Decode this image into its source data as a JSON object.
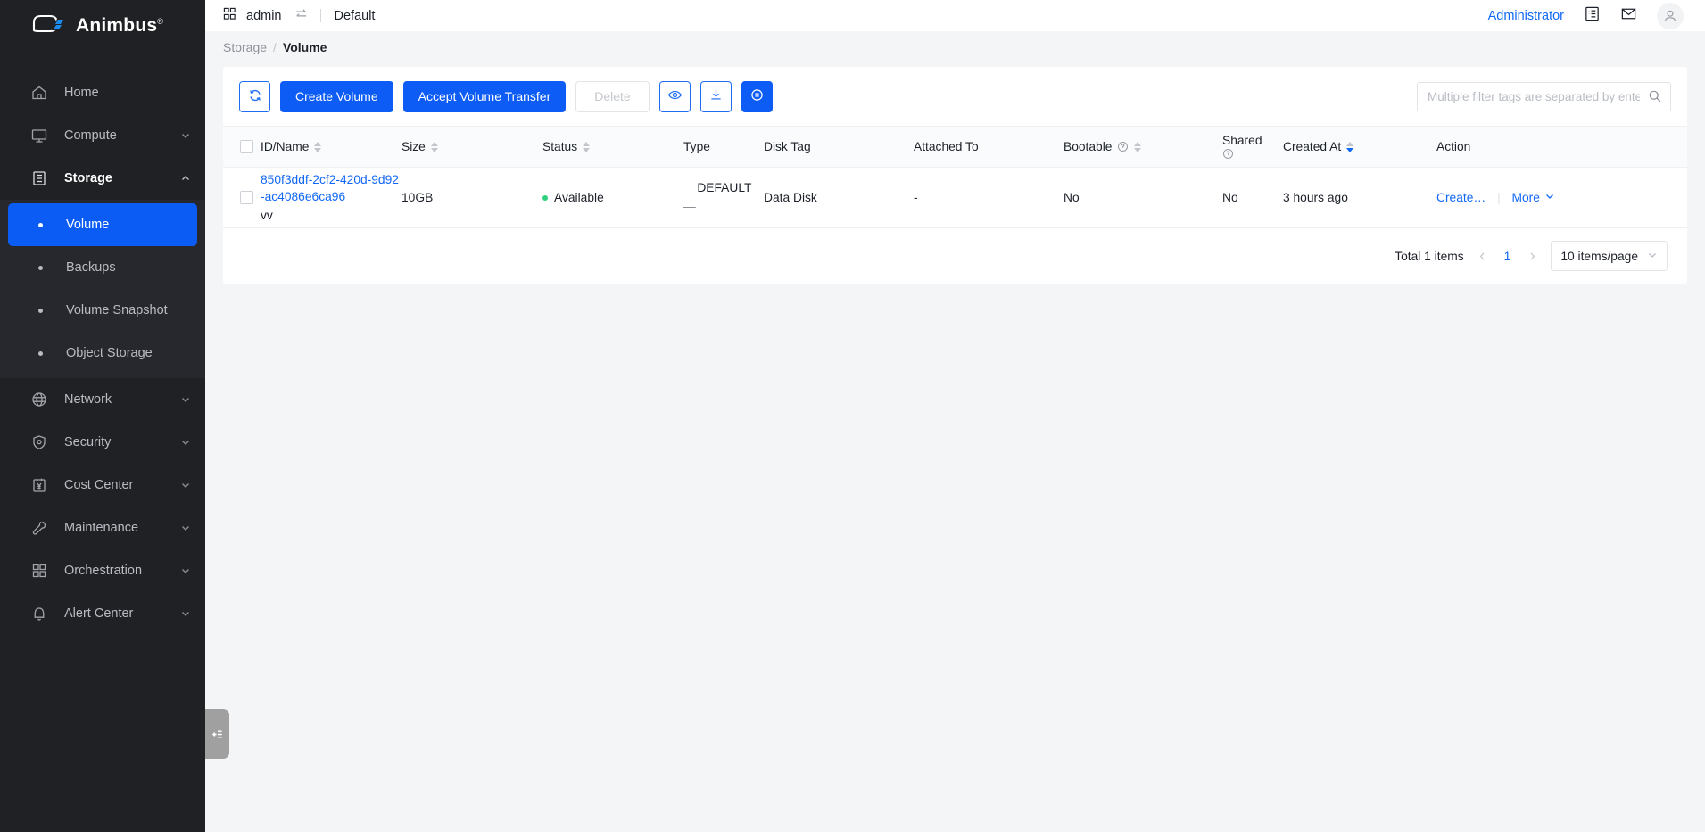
{
  "brand": {
    "name": "Animbus",
    "registered": "®"
  },
  "sidebar": {
    "items": [
      {
        "label": "Home",
        "icon": "home-icon",
        "expandable": false
      },
      {
        "label": "Compute",
        "icon": "monitor-icon",
        "expandable": true
      },
      {
        "label": "Storage",
        "icon": "server-rack-icon",
        "expandable": true,
        "expanded": true
      },
      {
        "label": "Network",
        "icon": "globe-icon",
        "expandable": true
      },
      {
        "label": "Security",
        "icon": "shield-icon",
        "expandable": true
      },
      {
        "label": "Cost Center",
        "icon": "yen-billing-icon",
        "expandable": true
      },
      {
        "label": "Maintenance",
        "icon": "wrench-icon",
        "expandable": true
      },
      {
        "label": "Orchestration",
        "icon": "grid-blocks-icon",
        "expandable": true
      },
      {
        "label": "Alert Center",
        "icon": "bell-icon",
        "expandable": true
      }
    ],
    "storage_children": [
      {
        "label": "Volume",
        "selected": true
      },
      {
        "label": "Backups",
        "selected": false
      },
      {
        "label": "Volume Snapshot",
        "selected": false
      },
      {
        "label": "Object Storage",
        "selected": false
      }
    ],
    "collapse_handle": "collapse-sidebar"
  },
  "topbar": {
    "project": "admin",
    "switch_icon": "switch-arrows-icon",
    "grid_icon": "grid-icon",
    "region": "Default",
    "administrator": "Administrator",
    "list_icon": "task-list-icon",
    "mail_icon": "envelope-icon",
    "avatar_icon": "user-avatar-icon"
  },
  "breadcrumb": {
    "parent": "Storage",
    "separator": "/",
    "current": "Volume"
  },
  "toolbar": {
    "refresh_icon": "refresh-icon",
    "create_volume": "Create Volume",
    "accept_transfer": "Accept Volume Transfer",
    "delete": "Delete",
    "view_icon": "eye-icon",
    "download_icon": "download-icon",
    "info_icon": "pause-circle-icon"
  },
  "search": {
    "placeholder": "Multiple filter tags are separated by enter",
    "value": "",
    "icon": "search-icon"
  },
  "table": {
    "columns": [
      {
        "label": "ID/Name",
        "sortable": true
      },
      {
        "label": "Size",
        "sortable": true
      },
      {
        "label": "Status",
        "sortable": true
      },
      {
        "label": "Type",
        "sortable": false
      },
      {
        "label": "Disk Tag",
        "sortable": false
      },
      {
        "label": "Attached To",
        "sortable": false
      },
      {
        "label": "Bootable",
        "sortable": true,
        "help": true
      },
      {
        "label": "Shared",
        "sortable": false,
        "help": true
      },
      {
        "label": "Created At",
        "sortable": true,
        "sort_active": "desc"
      },
      {
        "label": "Action",
        "sortable": false
      }
    ],
    "rows": [
      {
        "id": "850f3ddf-2cf2-420d-9d92-ac4086e6ca96",
        "name": "vv",
        "size": "10GB",
        "status": "Available",
        "type_main": "__DEFAULT",
        "type_sub": "—",
        "disk_tag": "Data Disk",
        "attached_to": "-",
        "bootable": "No",
        "shared": "No",
        "created_at": "3 hours ago",
        "action_primary": "Create…",
        "action_more": "More"
      }
    ]
  },
  "pagination": {
    "total": "Total 1 items",
    "prev_icon": "chevron-left-icon",
    "current_page": "1",
    "next_icon": "chevron-right-icon",
    "page_size": "10 items/page"
  },
  "colors": {
    "accent": "#0d5cf5",
    "link": "#1268f5",
    "sidebar_bg": "#1f2125",
    "status_green": "#2fd07c"
  }
}
